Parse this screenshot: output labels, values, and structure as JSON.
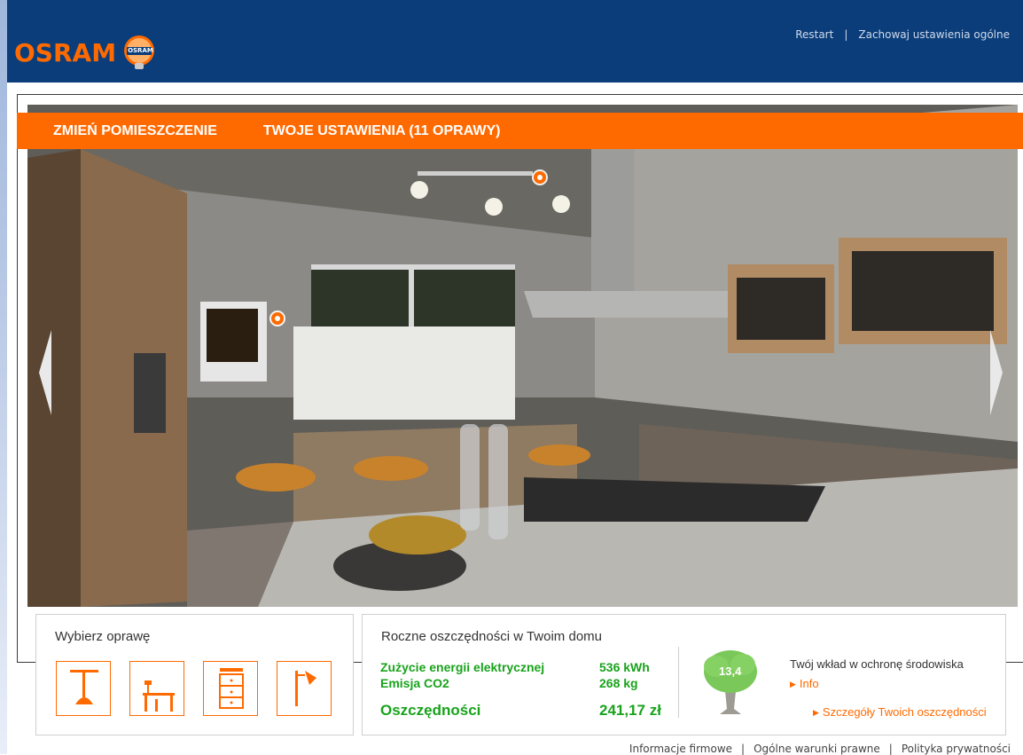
{
  "header": {
    "logo_text": "OSRAM",
    "logo_badge": "OSRAM",
    "links": [
      "Restart",
      "Zachowaj ustawienia ogólne"
    ],
    "separator": "|"
  },
  "tabs": [
    {
      "label": "ZMIEŃ POMIESZCZENIE"
    },
    {
      "label": "TWOJE USTAWIENIA (11 OPRAWY)"
    }
  ],
  "fixture_panel": {
    "title": "Wybierz oprawę",
    "fixtures": [
      "pendant-lamp-icon",
      "table-lamp-icon",
      "cabinet-light-icon",
      "wall-lamp-icon"
    ]
  },
  "savings_panel": {
    "title": "Roczne oszczędności w Twoim domu",
    "rows": [
      {
        "label": "Zużycie energii elektrycznej",
        "value": "536 kWh"
      },
      {
        "label": "Emisja CO2",
        "value": "268 kg"
      }
    ],
    "total_label": "Oszczędności",
    "total_value": "241,17 zł",
    "tree_value": "13,4",
    "env_text": "Twój wkład w ochronę środowiska",
    "info_link": "Info",
    "details_link": "Szczegóły Twoich oszczędności"
  },
  "footer": {
    "links": [
      "Informacje firmowe",
      "Ogólne warunki prawne",
      "Polityka prywatności"
    ],
    "separator": "|"
  },
  "colors": {
    "brand_orange": "#ff6a00",
    "header_blue": "#0a3d7a",
    "stat_green": "#18a31b"
  }
}
